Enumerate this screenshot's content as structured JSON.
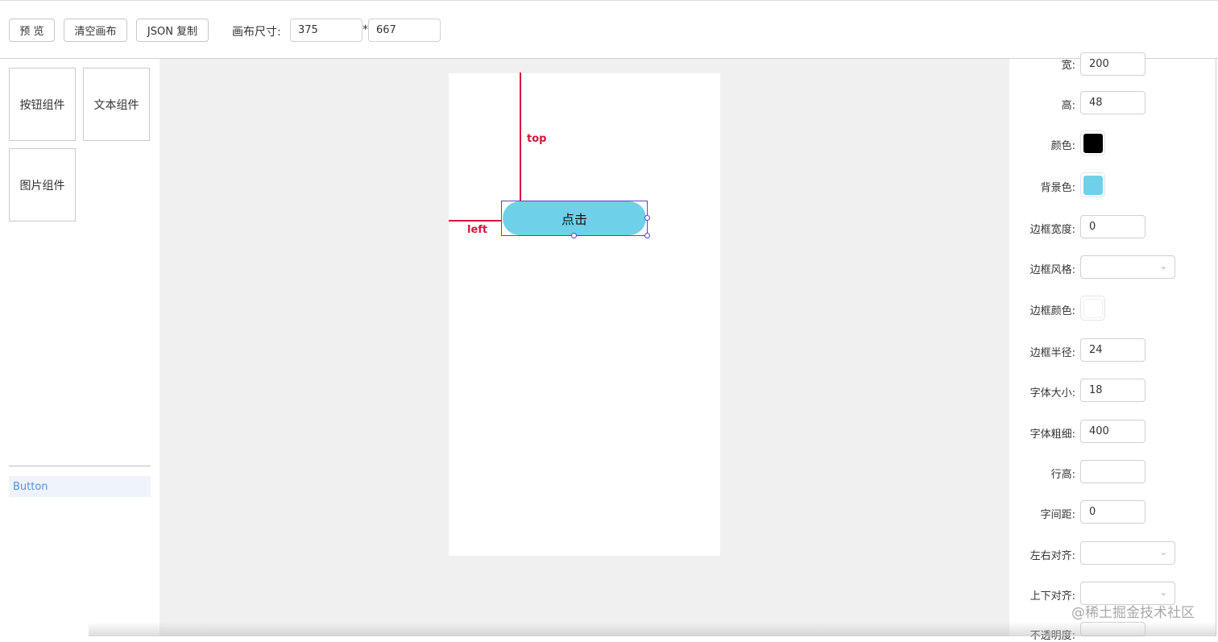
{
  "toolbar": {
    "preview_label": "预 览",
    "clear_label": "清空画布",
    "json_copy_label": "JSON 复制",
    "size_label": "画布尺寸:",
    "width_value": "375",
    "height_value": "667",
    "times": "*"
  },
  "components": [
    {
      "label": "按钮组件"
    },
    {
      "label": "文本组件"
    },
    {
      "label": "图片组件"
    }
  ],
  "layers": [
    {
      "label": "Button",
      "selected": true
    }
  ],
  "canvas": {
    "button_text": "点击",
    "guide_top_label": "top",
    "guide_left_label": "left",
    "button_color": "#6fd0ea",
    "guide_color": "#d6143c",
    "selection_color": "#5a3ee0"
  },
  "properties": {
    "width": {
      "label": "宽:",
      "value": "200"
    },
    "height": {
      "label": "高:",
      "value": "48"
    },
    "color": {
      "label": "颜色:",
      "value": "#000000"
    },
    "background": {
      "label": "背景色:",
      "value": "#6fd0ea"
    },
    "border_width": {
      "label": "边框宽度:",
      "value": "0"
    },
    "border_style": {
      "label": "边框风格:",
      "value": ""
    },
    "border_color": {
      "label": "边框颜色:",
      "value": "#ffffff"
    },
    "border_radius": {
      "label": "边框半径:",
      "value": "24"
    },
    "font_size": {
      "label": "字体大小:",
      "value": "18"
    },
    "font_weight": {
      "label": "字体粗细:",
      "value": "400"
    },
    "line_height": {
      "label": "行高:",
      "value": ""
    },
    "letter_spacing": {
      "label": "字间距:",
      "value": "0"
    },
    "text_align": {
      "label": "左右对齐:",
      "value": ""
    },
    "vertical_align": {
      "label": "上下对齐:",
      "value": ""
    },
    "opacity": {
      "label": "不透明度:",
      "value": ""
    }
  },
  "watermark": "@稀土掘金技术社区"
}
